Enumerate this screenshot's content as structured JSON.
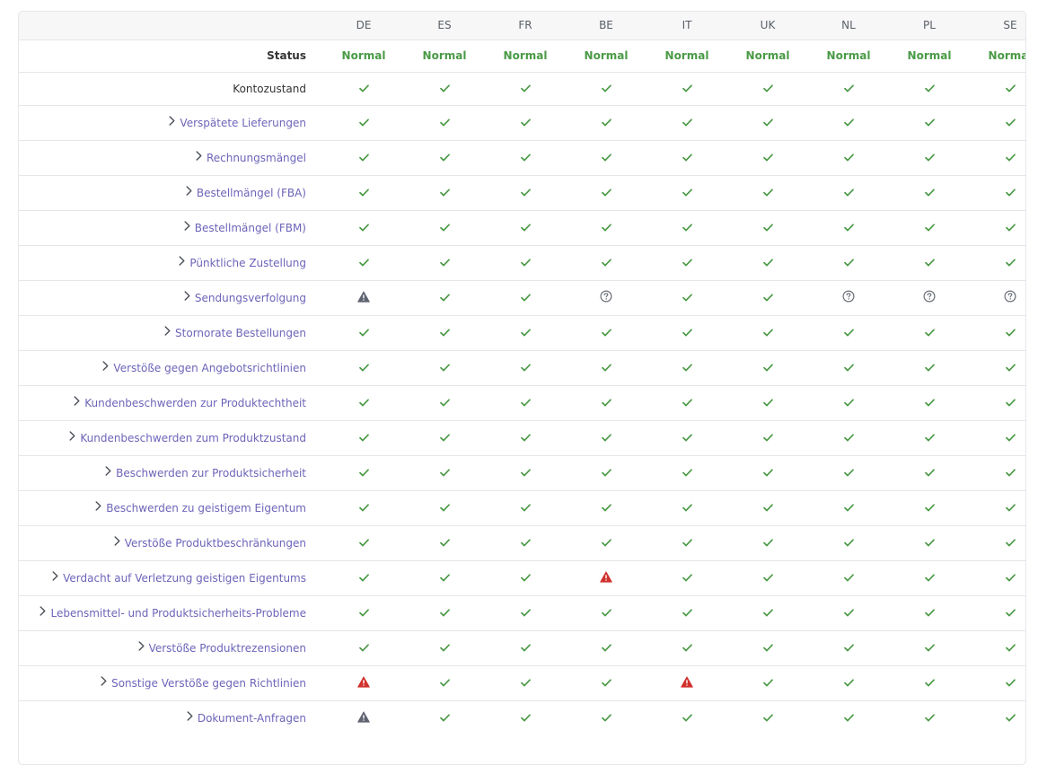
{
  "markets": [
    "DE",
    "ES",
    "FR",
    "BE",
    "IT",
    "UK",
    "NL",
    "PL",
    "SE"
  ],
  "status_row": {
    "label": "Status",
    "values": [
      "Normal",
      "Normal",
      "Normal",
      "Normal",
      "Normal",
      "Normal",
      "Normal",
      "Normal",
      "Normal"
    ]
  },
  "konto_row": {
    "label": "Kontozustand",
    "cells": [
      "check",
      "check",
      "check",
      "check",
      "check",
      "check",
      "check",
      "check",
      "check"
    ]
  },
  "metrics": [
    {
      "label": "Verspätete Lieferungen",
      "cells": [
        "check",
        "check",
        "check",
        "check",
        "check",
        "check",
        "check",
        "check",
        "check"
      ]
    },
    {
      "label": "Rechnungsmängel",
      "cells": [
        "check",
        "check",
        "check",
        "check",
        "check",
        "check",
        "check",
        "check",
        "check"
      ]
    },
    {
      "label": "Bestellmängel (FBA)",
      "cells": [
        "check",
        "check",
        "check",
        "check",
        "check",
        "check",
        "check",
        "check",
        "check"
      ]
    },
    {
      "label": "Bestellmängel (FBM)",
      "cells": [
        "check",
        "check",
        "check",
        "check",
        "check",
        "check",
        "check",
        "check",
        "check"
      ]
    },
    {
      "label": "Pünktliche Zustellung",
      "cells": [
        "check",
        "check",
        "check",
        "check",
        "check",
        "check",
        "check",
        "check",
        "check"
      ]
    },
    {
      "label": "Sendungsverfolgung",
      "cells": [
        "warning-gray",
        "check",
        "check",
        "question",
        "check",
        "check",
        "question",
        "question",
        "question"
      ]
    },
    {
      "label": "Stornorate Bestellungen",
      "cells": [
        "check",
        "check",
        "check",
        "check",
        "check",
        "check",
        "check",
        "check",
        "check"
      ]
    },
    {
      "label": "Verstöße gegen Angebotsrichtlinien",
      "cells": [
        "check",
        "check",
        "check",
        "check",
        "check",
        "check",
        "check",
        "check",
        "check"
      ]
    },
    {
      "label": "Kundenbeschwerden zur Produktechtheit",
      "cells": [
        "check",
        "check",
        "check",
        "check",
        "check",
        "check",
        "check",
        "check",
        "check"
      ]
    },
    {
      "label": "Kundenbeschwerden zum Produktzustand",
      "cells": [
        "check",
        "check",
        "check",
        "check",
        "check",
        "check",
        "check",
        "check",
        "check"
      ]
    },
    {
      "label": "Beschwerden zur Produktsicherheit",
      "cells": [
        "check",
        "check",
        "check",
        "check",
        "check",
        "check",
        "check",
        "check",
        "check"
      ]
    },
    {
      "label": "Beschwerden zu geistigem Eigentum",
      "cells": [
        "check",
        "check",
        "check",
        "check",
        "check",
        "check",
        "check",
        "check",
        "check"
      ]
    },
    {
      "label": "Verstöße Produktbeschränkungen",
      "cells": [
        "check",
        "check",
        "check",
        "check",
        "check",
        "check",
        "check",
        "check",
        "check"
      ]
    },
    {
      "label": "Verdacht auf Verletzung geistigen Eigentums",
      "cells": [
        "check",
        "check",
        "check",
        "warning-red",
        "check",
        "check",
        "check",
        "check",
        "check"
      ]
    },
    {
      "label": "Lebensmittel- und Produktsicherheits-Probleme",
      "cells": [
        "check",
        "check",
        "check",
        "check",
        "check",
        "check",
        "check",
        "check",
        "check"
      ]
    },
    {
      "label": "Verstöße Produktrezensionen",
      "cells": [
        "check",
        "check",
        "check",
        "check",
        "check",
        "check",
        "check",
        "check",
        "check"
      ]
    },
    {
      "label": "Sonstige Verstöße gegen Richtlinien",
      "cells": [
        "warning-red",
        "check",
        "check",
        "check",
        "warning-red",
        "check",
        "check",
        "check",
        "check"
      ]
    },
    {
      "label": "Dokument-Anfragen",
      "cells": [
        "warning-gray",
        "check",
        "check",
        "check",
        "check",
        "check",
        "check",
        "check",
        "check"
      ]
    }
  ],
  "colors": {
    "check": "#4a9a46",
    "warning_red": "#d0312d",
    "warning_gray": "#5f6470",
    "question": "#6b7078",
    "link": "#6c64b8",
    "status_normal": "#4a9a46",
    "border": "#e4e6ea",
    "header_bg": "#f7f7f8"
  }
}
